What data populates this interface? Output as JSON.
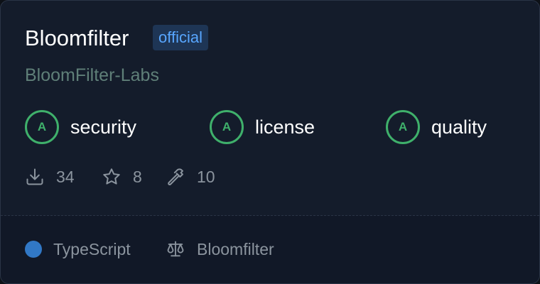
{
  "package": {
    "name": "Bloomfilter",
    "badge": "official",
    "org": "BloomFilter-Labs"
  },
  "scores": [
    {
      "grade": "A",
      "label": "security"
    },
    {
      "grade": "A",
      "label": "license"
    },
    {
      "grade": "A",
      "label": "quality"
    }
  ],
  "stats": {
    "downloads": "34",
    "stars": "8",
    "dependents": "10"
  },
  "footer": {
    "language": "TypeScript",
    "license": "Bloomfilter"
  },
  "colors": {
    "card_background": "#141c2b",
    "footer_background": "#111827",
    "badge_background": "#1e3555",
    "badge_text": "#58a6ff",
    "grade_green": "#3fb06b",
    "muted_text": "#8b949e",
    "org_text": "#5f7f78",
    "typescript_dot": "#3178c6"
  },
  "icons": {
    "downloads": "download-icon",
    "stars": "star-icon",
    "dependents": "hammer-icon",
    "license": "scale-icon"
  }
}
